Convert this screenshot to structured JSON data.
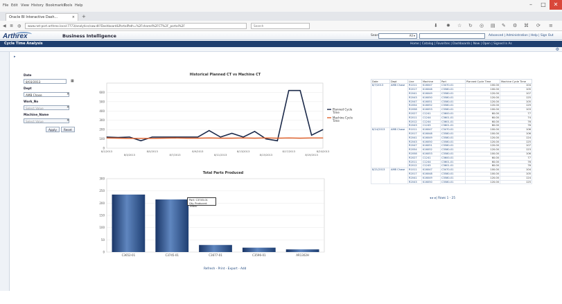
{
  "browser": {
    "menu": [
      "File",
      "Edit",
      "View",
      "History",
      "Bookmarks",
      "Tools",
      "Help"
    ],
    "tab_title": "Oracle BI Interactive Dash...",
    "url": "www.net-port.arthrex.local:7773/analytics/saw.dll?Dashboard&PortalPath=%2Fshared%2FCT%2F_portal%2F",
    "search_placeholder": "Search"
  },
  "obiee": {
    "brand": "Arthrex",
    "title": "Business Intelligence",
    "search_label": "Search",
    "search_scope": "All",
    "top_links": "Advanced | Administration | Help | Sign Out",
    "dashboard_title": "Cycle Time Analysis",
    "nav_links": "Home | Catalog | Favorites | Dashboards | New | Open | Signed In As"
  },
  "prompts": {
    "date_label": "Date",
    "date_value": "8/03/2013",
    "dept_label": "Dept",
    "dept_value": "AMB Chase",
    "work_no_label": "Work_No",
    "work_no_value": "Select Value",
    "machine_label": "Machine_Name",
    "machine_value": "Select Value",
    "apply": "Apply",
    "reset": "Reset"
  },
  "colors": {
    "planned": "#1c2a4a",
    "machine": "#e0622c",
    "bar": "#2c4f86",
    "header": "#1f3f6f"
  },
  "chart_data": [
    {
      "type": "line",
      "title": "Historical Planned CT vs Machine CT",
      "x": [
        "8/1/2013",
        "8/2/2013",
        "8/3/2013",
        "8/4/2013",
        "8/5/2013",
        "8/6/2013",
        "8/7/2013",
        "8/8/2013",
        "8/9/2013",
        "8/10/2013",
        "8/11/2013",
        "8/12/2013",
        "8/13/2013",
        "8/14/2013",
        "8/15/2013",
        "8/16/2013",
        "8/17/2013",
        "8/18/2013",
        "8/19/2013",
        "8/20/2013"
      ],
      "x_tick_labels": [
        "8/1/2013",
        "8/3/2013",
        "8/5/2013",
        "8/7/2013",
        "8/9/2013",
        "8/11/2013",
        "8/13/2013",
        "8/15/2013",
        "8/17/2013",
        "8/19/2013",
        "8/20/2013"
      ],
      "series": [
        {
          "name": "Planned Cycle Time",
          "values": [
            120,
            115,
            120,
            80,
            120,
            120,
            120,
            120,
            120,
            190,
            120,
            160,
            120,
            180,
            100,
            80,
            620,
            620,
            140,
            200
          ]
        },
        {
          "name": "Machine Cycle Time",
          "values": [
            110,
            108,
            106,
            106,
            106,
            108,
            110,
            108,
            108,
            110,
            108,
            108,
            110,
            108,
            110,
            108,
            110,
            108,
            110,
            110
          ]
        }
      ],
      "y_ticks": [
        0,
        100,
        200,
        300,
        400,
        500,
        600
      ],
      "ylim": [
        0,
        700
      ]
    },
    {
      "type": "bar",
      "title": "Total Parts Produced",
      "categories": [
        "C3652-01",
        "C3745-01",
        "C3677-01",
        "C3596-01",
        "AR1302H"
      ],
      "values": [
        235,
        215,
        29,
        18,
        11
      ],
      "y_ticks": [
        0,
        50,
        100,
        150,
        200,
        250,
        300
      ],
      "ylim": [
        0,
        300
      ],
      "tooltip": [
        "Part: C3745-01",
        "Qty. Produced: 19850"
      ]
    }
  ],
  "table": {
    "headers": [
      "Date",
      "Dept",
      "Line",
      "Machine",
      "Part",
      "Planned Cycle Time",
      "Machine Cycle Time"
    ],
    "groups": [
      {
        "date": "8/7/2013",
        "dept": "AMB Chase",
        "rows": [
          [
            "R1011",
            "K16047",
            "C3470-01",
            "100.00",
            "104"
          ],
          [
            "R2017",
            "K16048",
            "C3580-01",
            "100.00",
            "105"
          ],
          [
            "R2041",
            "K16049",
            "C3580-01",
            "120.00",
            "107"
          ],
          [
            "R2043",
            "K16050",
            "C3580-01",
            "120.00",
            "125"
          ],
          [
            "R2047",
            "K16051",
            "C3580-01",
            "120.00",
            "105"
          ],
          [
            "R2054",
            "K16052",
            "C3580-01",
            "120.00",
            "129"
          ],
          [
            "R2058",
            "K16053",
            "C3580-01",
            "100.00",
            "103"
          ],
          [
            "R2027",
            "C1241",
            "C3600-01",
            "60.00",
            "77"
          ],
          [
            "R2011",
            "C1244",
            "C3601-01",
            "60.00",
            "74"
          ],
          [
            "R2012",
            "C1244",
            "C3601-01",
            "60.00",
            "76"
          ],
          [
            "R2043",
            "C1245",
            "C3601-01",
            "60.00",
            "76"
          ]
        ]
      },
      {
        "date": "8/14/2013",
        "dept": "AMB Chase",
        "rows": [
          [
            "R1011",
            "K16047",
            "C3470-01",
            "100.00",
            "106"
          ],
          [
            "R2017",
            "K16048",
            "C3580-01",
            "100.00",
            "106"
          ],
          [
            "R2041",
            "K16049",
            "C3580-01",
            "120.00",
            "124"
          ],
          [
            "R2043",
            "K16050",
            "C3580-01",
            "120.00",
            "125"
          ],
          [
            "R2047",
            "K16051",
            "C3580-01",
            "120.00",
            "107"
          ],
          [
            "R2054",
            "K16052",
            "C3580-01",
            "120.00",
            "123"
          ],
          [
            "R2058",
            "K16053",
            "C3580-01",
            "100.00",
            "106"
          ],
          [
            "R2027",
            "C1241",
            "C3600-01",
            "60.00",
            "77"
          ],
          [
            "R2011",
            "C1244",
            "C3601-01",
            "60.00",
            "76"
          ],
          [
            "R2012",
            "C1245",
            "C3601-01",
            "60.00",
            "76"
          ]
        ]
      },
      {
        "date": "8/21/2013",
        "dept": "AMB Chase",
        "rows": [
          [
            "R1011",
            "K16047",
            "C3470-01",
            "100.00",
            "104"
          ],
          [
            "R2017",
            "K16048",
            "C3580-01",
            "100.00",
            "105"
          ],
          [
            "R2041",
            "K16049",
            "C3580-01",
            "120.00",
            "124"
          ],
          [
            "R2043",
            "K16050",
            "C3580-01",
            "120.00",
            "125"
          ]
        ]
      }
    ],
    "pager": "Rows 1 - 25"
  },
  "footer_links": "Refresh - Print - Export - Add"
}
